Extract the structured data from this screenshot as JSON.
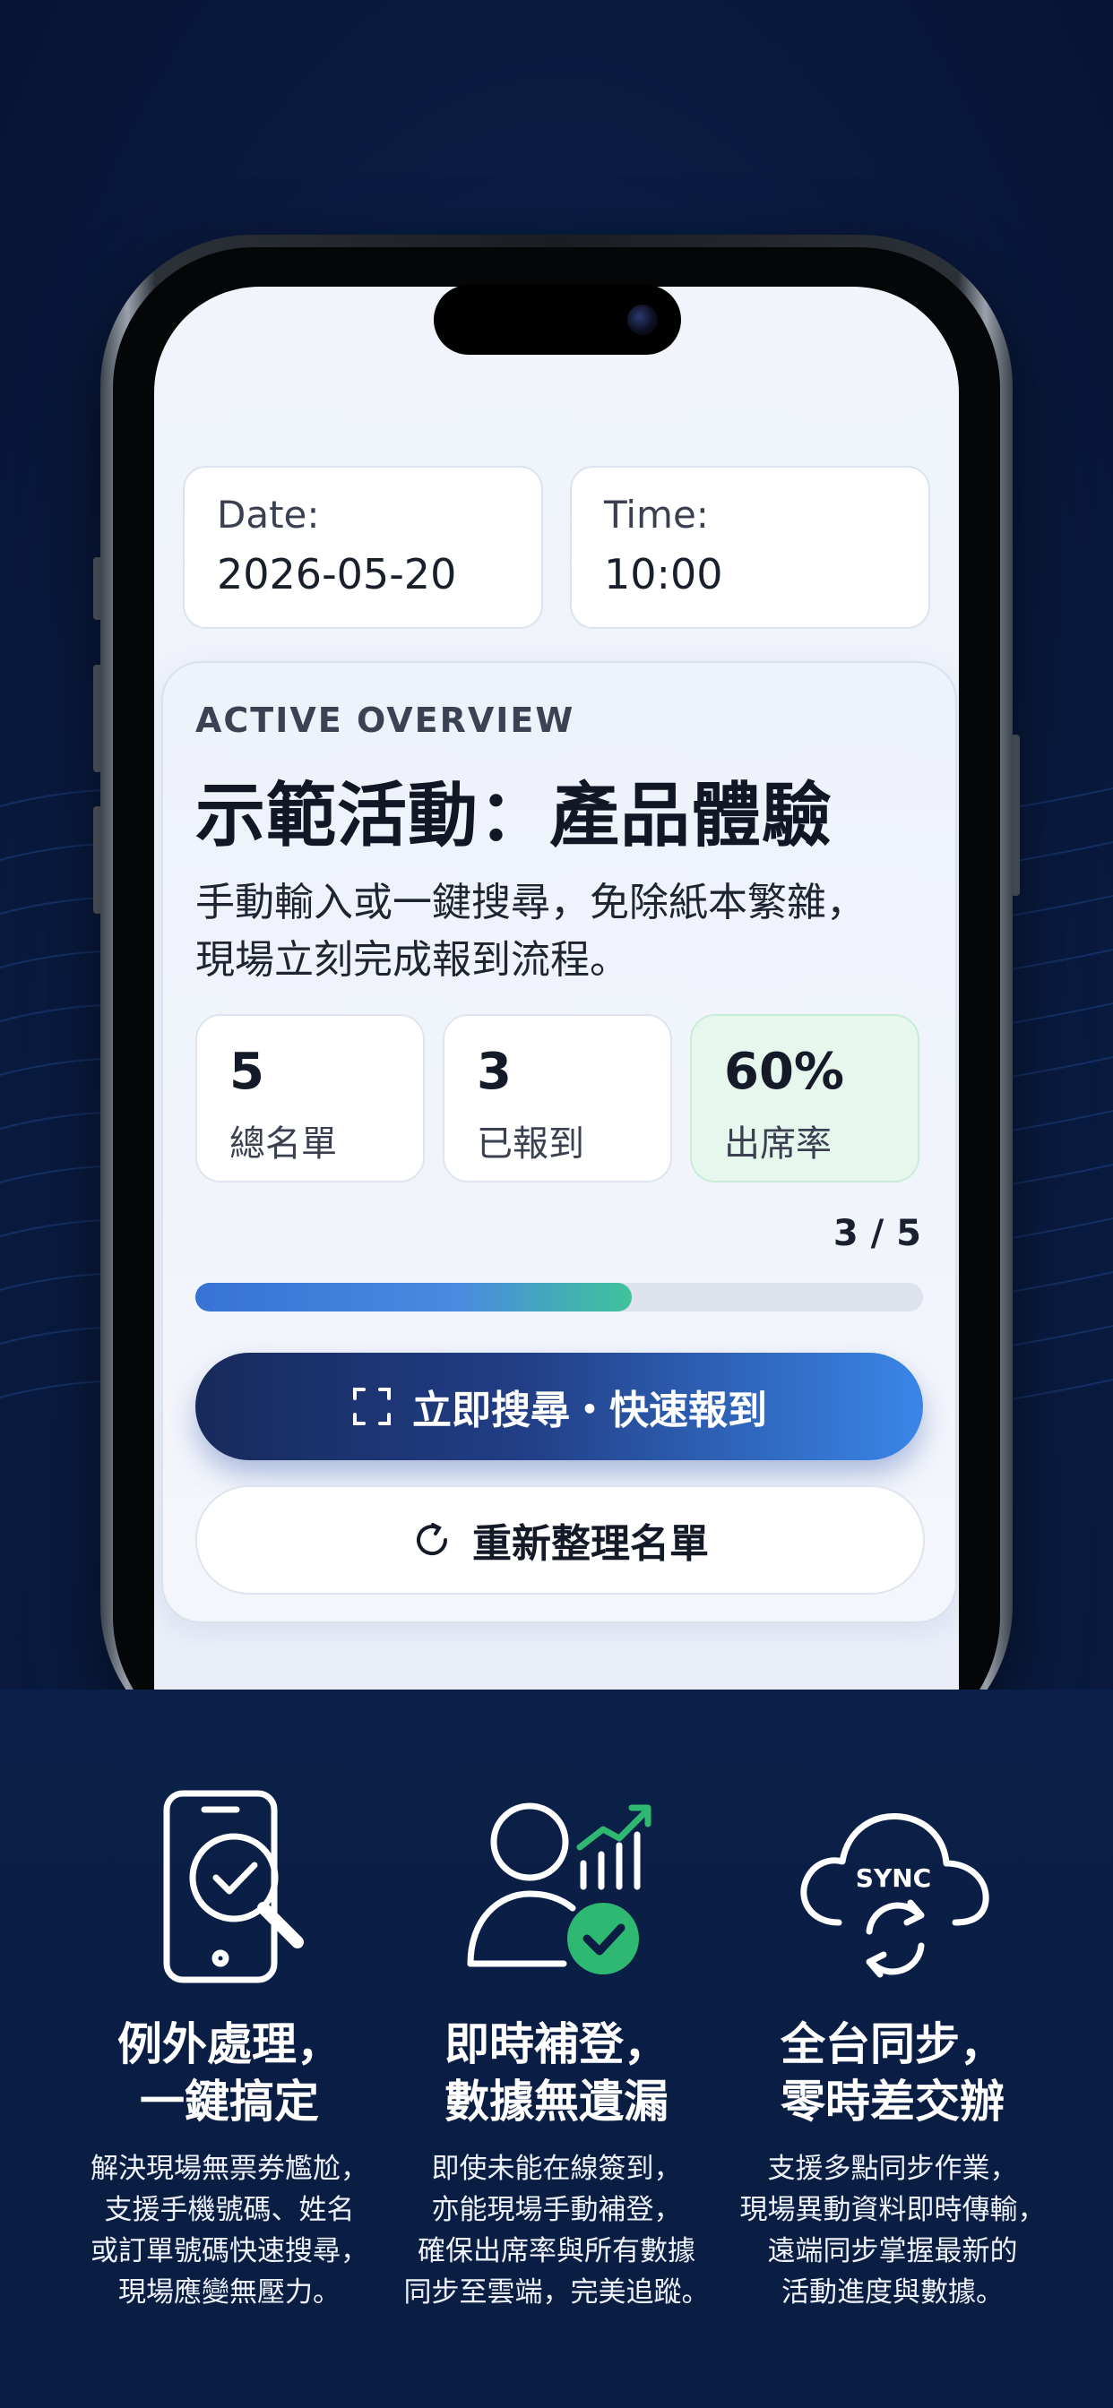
{
  "screen": {
    "date_card": {
      "label": "Date:",
      "value": "2026-05-20"
    },
    "time_card": {
      "label": "Time:",
      "value": "10:00"
    },
    "overview": {
      "eyebrow": "ACTIVE OVERVIEW",
      "title": "示範活動：產品體驗",
      "description_line1": "手動輸入或一鍵搜尋，免除紙本繁雜，",
      "description_line2": "現場立刻完成報到流程。",
      "stats": [
        {
          "value": "5",
          "label": "總名單"
        },
        {
          "value": "3",
          "label": "已報到"
        },
        {
          "value": "60%",
          "label": "出席率"
        }
      ],
      "progress_text": "3 / 5",
      "progress_fraction": 0.6,
      "primary_button": "立即搜尋・快速報到",
      "secondary_button": "重新整理名單"
    }
  },
  "features": [
    {
      "icon": "phone-search-check-icon",
      "title_line1": "例外處理，",
      "title_line2": "一鍵搞定",
      "text": [
        "解決現場無票券尷尬，",
        "支援手機號碼、姓名",
        "或訂單號碼快速搜尋，",
        "現場應變無壓力。"
      ]
    },
    {
      "icon": "user-check-chart-icon",
      "title_line1": "即時補登，",
      "title_line2": "數據無遺漏",
      "text": [
        "即使未能在線簽到，",
        "亦能現場手動補登，",
        "確保出席率與所有數據",
        "同步至雲端，完美追蹤。"
      ]
    },
    {
      "icon": "cloud-sync-icon",
      "icon_text": "SYNC",
      "title_line1": "全台同步，",
      "title_line2": "零時差交辦",
      "text": [
        "支援多點同步作業，",
        "現場異動資料即時傳輸，",
        "遠端同步掌握最新的",
        "活動進度與數據。"
      ]
    }
  ],
  "colors": {
    "background": "#0b1f48",
    "accent_blue": "#3a86e8",
    "accent_green": "#2eb872",
    "button_dark": "#172a5c"
  }
}
